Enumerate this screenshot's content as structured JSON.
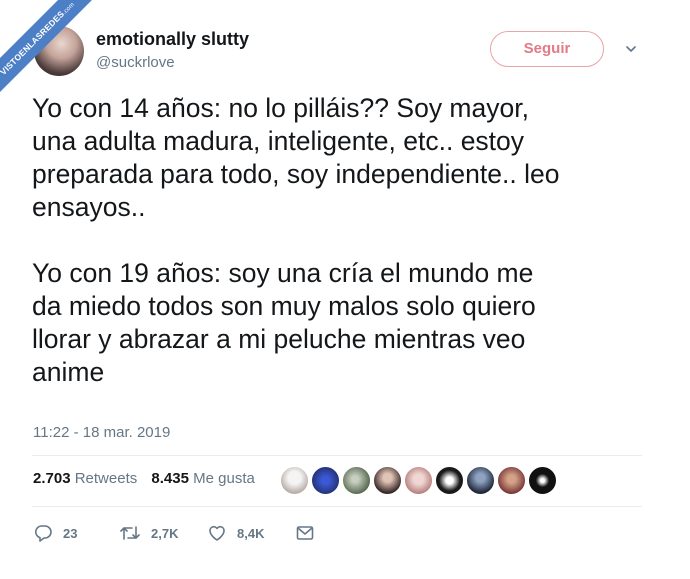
{
  "watermark": {
    "text": "VISTOENLASREDES",
    "domain": ".com"
  },
  "tweet": {
    "author_name": "emotionally slutty",
    "author_handle": "@suckrlove",
    "follow_label": "Seguir",
    "paragraph1_lines": [
      "Yo con 14 años: no lo pilláis?? Soy mayor,",
      "una adulta madura, inteligente, etc.. estoy",
      "preparada para todo, soy independiente.. leo",
      "ensayos.."
    ],
    "paragraph2_lines": [
      "Yo con 19 años: soy una cría el mundo me",
      "da miedo todos son muy malos solo quiero",
      "llorar y abrazar a mi peluche mientras veo",
      "anime"
    ],
    "timestamp": "11:22 - 18 mar. 2019"
  },
  "stats": {
    "retweets_count": "2.703",
    "retweets_label": "Retweets",
    "likes_count": "8.435",
    "likes_label": "Me gusta"
  },
  "actions": {
    "reply_count": "23",
    "retweet_count": "2,7K",
    "like_count": "8,4K"
  },
  "colors": {
    "follow_accent": "#e27b86",
    "secondary_text": "#657786",
    "watermark_ribbon": "#4d7fc7"
  },
  "icons": [
    "chevron-down-icon",
    "reply-icon",
    "retweet-icon",
    "heart-icon",
    "message-icon"
  ]
}
